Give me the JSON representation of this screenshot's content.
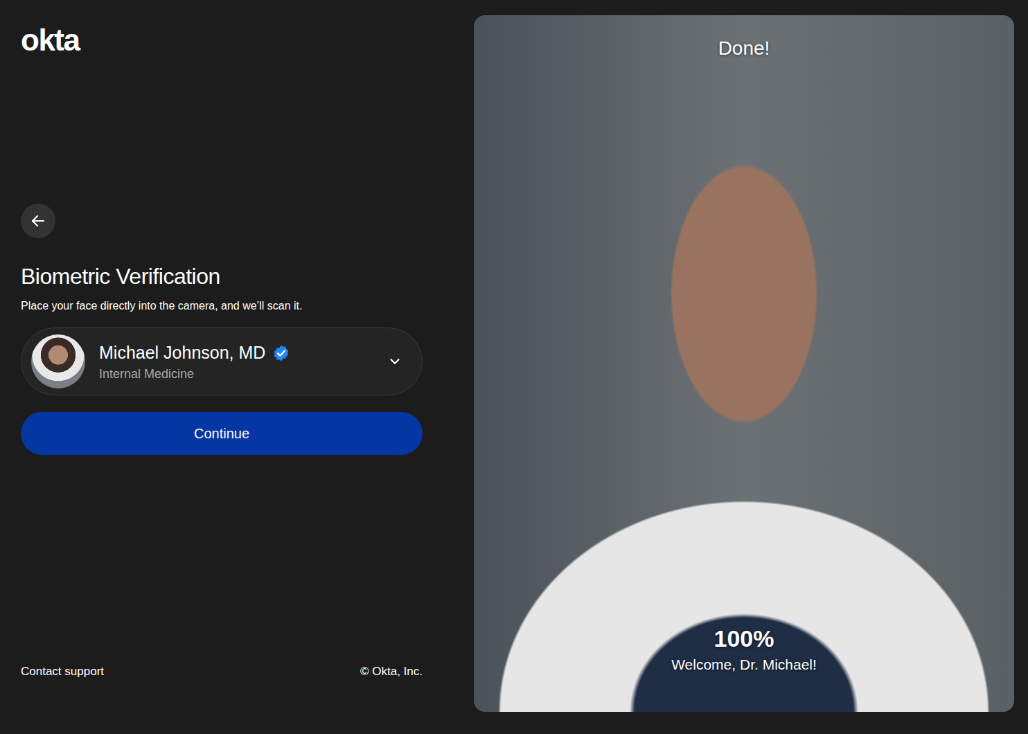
{
  "brand": {
    "logo": "okta"
  },
  "page": {
    "title": "Biometric Verification",
    "instruction": "Place your face directly into the camera, and we’ll scan it."
  },
  "account": {
    "name": "Michael Johnson, MD",
    "specialty": "Internal Medicine",
    "verified": true
  },
  "buttons": [
    {
      "label": "Continue"
    }
  ],
  "footer": {
    "support": "Contact support",
    "copyright": "© Okta, Inc."
  },
  "scan": {
    "status": "Done!",
    "progress": "100%",
    "message": "Welcome, Dr. Michael!"
  }
}
